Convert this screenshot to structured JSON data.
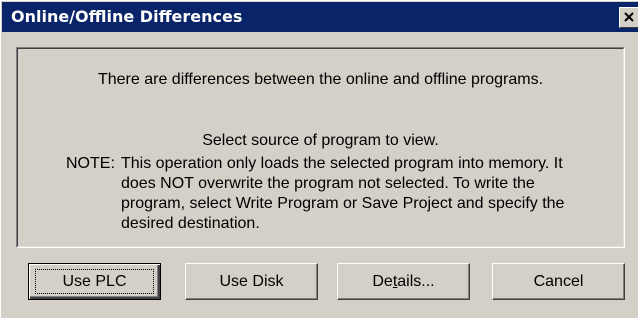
{
  "window": {
    "title": "Online/Offline Differences",
    "close_label": "Close"
  },
  "message": {
    "line1": "There are differences between the online and offline programs.",
    "line2": "Select source of program to view.",
    "note_label": "NOTE:",
    "note_text": "This operation only loads the selected program into memory. It\ndoes NOT overwrite the program not selected. To write the\nprogram, select Write Program or Save Project and specify the\ndesired destination."
  },
  "buttons": {
    "use_plc": "Use PLC",
    "use_disk": "Use Disk",
    "details_pre": "De",
    "details_underlined": "t",
    "details_post": "ails...",
    "cancel": "Cancel"
  },
  "colors": {
    "titlebar": "#0a246a",
    "dialog_face": "#d4d0c8"
  }
}
